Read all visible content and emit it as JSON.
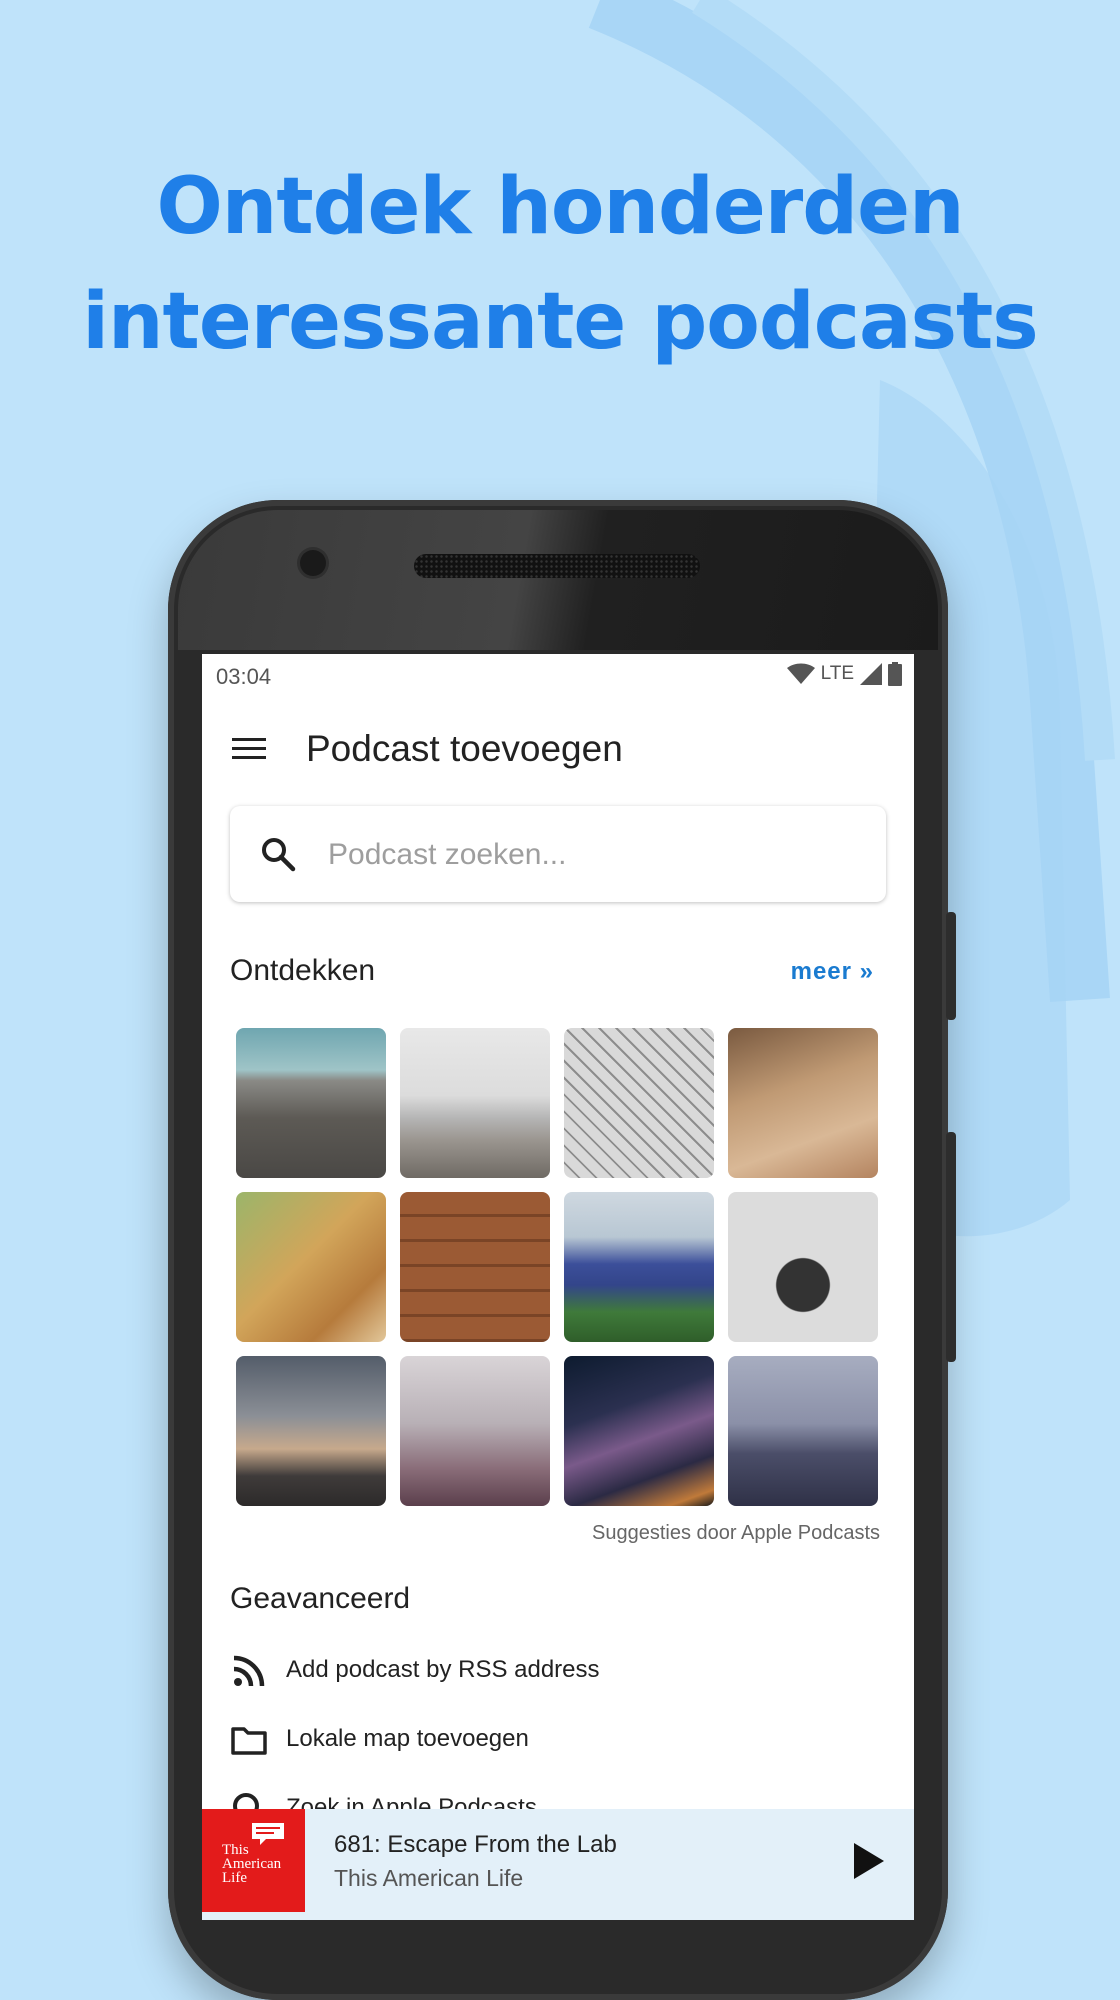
{
  "headline": {
    "line1": "Ontdek honderden",
    "line2": "interessante podcasts"
  },
  "status_bar": {
    "time": "03:04",
    "network": "LTE"
  },
  "app_bar": {
    "title": "Podcast toevoegen"
  },
  "search": {
    "placeholder": "Podcast zoeken..."
  },
  "discover": {
    "title": "Ontdekken",
    "more_label": "meer »",
    "credit": "Suggesties door Apple Podcasts",
    "tiles": [
      "pebble-beach",
      "snowy-mountain",
      "glass-roof",
      "pencils",
      "bamboo-pipes",
      "wood-planks",
      "blue-flowers",
      "typewriter",
      "city-tower",
      "foggy-trees",
      "milky-way",
      "misty-sea"
    ]
  },
  "advanced": {
    "title": "Geavanceerd",
    "items": [
      {
        "label": "Add podcast by RSS address",
        "icon": "rss-icon"
      },
      {
        "label": "Lokale map toevoegen",
        "icon": "folder-icon"
      },
      {
        "label": "Zoek in Apple Podcasts",
        "icon": "search-icon"
      }
    ]
  },
  "player": {
    "track": "681: Escape From the Lab",
    "show": "This American Life",
    "cover_text": "This American Life"
  },
  "colors": {
    "background": "#bfe3fa",
    "headline": "#1f7fe8",
    "accent": "#1a7bd0",
    "player_bg": "#e3f0f9",
    "cover_red": "#e31b1b"
  }
}
